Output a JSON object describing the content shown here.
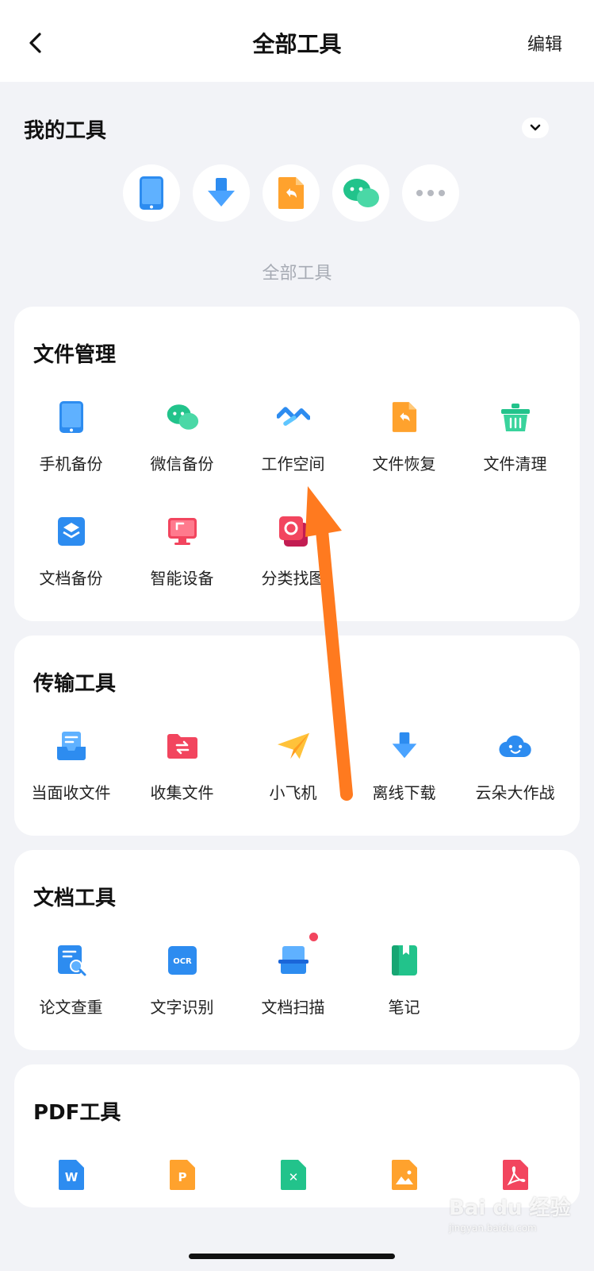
{
  "header": {
    "title": "全部工具",
    "edit_label": "编辑"
  },
  "my_tools": {
    "title": "我的工具",
    "items": [
      {
        "name": "phone-backup-icon"
      },
      {
        "name": "download-icon"
      },
      {
        "name": "file-restore-icon"
      },
      {
        "name": "wechat-icon"
      },
      {
        "name": "more-icon"
      }
    ]
  },
  "all_tools_label": "全部工具",
  "sections": {
    "file_mgmt": {
      "title": "文件管理",
      "items": [
        "手机备份",
        "微信备份",
        "工作空间",
        "文件恢复",
        "文件清理",
        "文档备份",
        "智能设备",
        "分类找图"
      ]
    },
    "transfer": {
      "title": "传输工具",
      "items": [
        "当面收文件",
        "收集文件",
        "小飞机",
        "离线下载",
        "云朵大作战"
      ]
    },
    "doc_tools": {
      "title": "文档工具",
      "items": [
        "论文查重",
        "文字识别",
        "文档扫描",
        "笔记"
      ],
      "ocr_text": "OCR"
    },
    "pdf_tools": {
      "title": "PDF工具",
      "glyphs": [
        "W",
        "P",
        "✕"
      ]
    }
  },
  "watermark": {
    "text": "Bai du 经验",
    "sub": "jingyan.baidu.com"
  },
  "colors": {
    "blue": "#2d8cf0",
    "green": "#22c38b",
    "orange": "#ffa22d",
    "red": "#f2455e",
    "annotation_arrow": "#ff7a1f"
  }
}
